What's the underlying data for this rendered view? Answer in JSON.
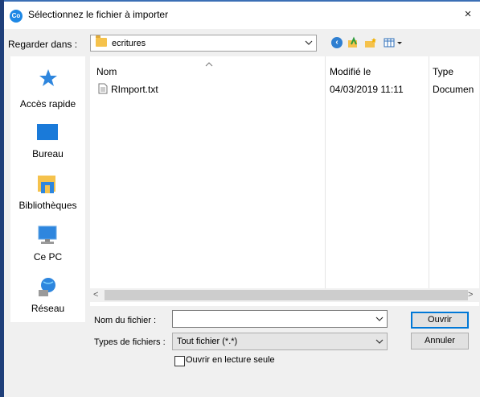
{
  "window": {
    "title": "Sélectionnez le fichier à importer",
    "app_icon": "Co",
    "close_symbol": "×"
  },
  "look_in": {
    "label": "Regarder dans :",
    "value": "ecritures"
  },
  "places": [
    {
      "label": "Accès rapide",
      "icon": "star-icon"
    },
    {
      "label": "Bureau",
      "icon": "desktop-icon"
    },
    {
      "label": "Bibliothèques",
      "icon": "libraries-icon"
    },
    {
      "label": "Ce PC",
      "icon": "computer-icon"
    },
    {
      "label": "Réseau",
      "icon": "network-icon"
    }
  ],
  "file_list": {
    "columns": [
      "Nom",
      "Modifié le",
      "Type"
    ],
    "rows": [
      {
        "name": "RImport.txt",
        "modified": "04/03/2019 11:11",
        "type": "Documen"
      }
    ]
  },
  "scroll": {
    "left": "<",
    "right": ">"
  },
  "filename": {
    "label": "Nom du fichier :",
    "value": ""
  },
  "filetype": {
    "label": "Types de fichiers :",
    "value": "Tout fichier (*.*)"
  },
  "readonly": {
    "label": "Ouvrir en lecture seule",
    "checked": false
  },
  "buttons": {
    "open": "Ouvrir",
    "cancel": "Annuler"
  },
  "colors": {
    "accent": "#0078d7",
    "folder": "#f5c24c"
  }
}
